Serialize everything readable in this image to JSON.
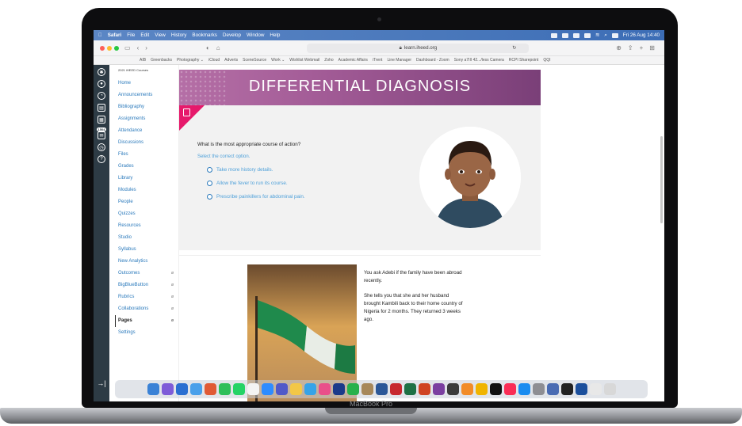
{
  "menubar": {
    "app": "Safari",
    "items": [
      "File",
      "Edit",
      "View",
      "History",
      "Bookmarks",
      "Develop",
      "Window",
      "Help"
    ],
    "clock": "Fri 26 Aug  14:40"
  },
  "toolbar": {
    "url": "learn.iheed.org",
    "favorites": [
      "AIB",
      "Greenbacks",
      "Photography ⌄",
      "iCloud",
      "Adverts",
      "SceneSource",
      "Work ⌄",
      "Wishlist Webmail",
      "Zoho",
      "Academic Affairs",
      "iTrent",
      "Line Manager",
      "Dashboard - Zoom",
      "Sony a7III 42.../less Camera",
      "RCPI Sharepoint",
      "QQI"
    ]
  },
  "global_nav": {
    "badge": "1504"
  },
  "course_nav": {
    "crumb": "2021 iHEED Courses",
    "items": [
      {
        "label": "Home",
        "eye": ""
      },
      {
        "label": "Announcements",
        "eye": ""
      },
      {
        "label": "Bibliography",
        "eye": ""
      },
      {
        "label": "Assignments",
        "eye": ""
      },
      {
        "label": "Attendance",
        "eye": ""
      },
      {
        "label": "Discussions",
        "eye": ""
      },
      {
        "label": "Files",
        "eye": ""
      },
      {
        "label": "Grades",
        "eye": ""
      },
      {
        "label": "Library",
        "eye": ""
      },
      {
        "label": "Modules",
        "eye": ""
      },
      {
        "label": "People",
        "eye": ""
      },
      {
        "label": "Quizzes",
        "eye": ""
      },
      {
        "label": "Resources",
        "eye": ""
      },
      {
        "label": "Studio",
        "eye": ""
      },
      {
        "label": "Syllabus",
        "eye": ""
      },
      {
        "label": "New Analytics",
        "eye": ""
      },
      {
        "label": "Outcomes",
        "eye": "ø"
      },
      {
        "label": "BigBlueButton",
        "eye": "ø"
      },
      {
        "label": "Rubrics",
        "eye": "ø"
      },
      {
        "label": "Collaborations",
        "eye": "ø"
      },
      {
        "label": "Pages",
        "eye": "ø"
      },
      {
        "label": "Settings",
        "eye": ""
      }
    ]
  },
  "page": {
    "banner_title": "DIFFERENTIAL DIAGNOSIS",
    "question": "What is the most appropriate course of action?",
    "hint": "Select the correct option.",
    "options": [
      "Take more history details.",
      "Allow the fever to run its course.",
      "Prescribe painkillers for abdominal pain."
    ],
    "story": [
      "You ask Adebi if the family have been abroad recently.",
      "She tells you that she and her husband brought Kambili back to their home country of Nigeria for 2 months. They returned 3 weeks ago."
    ]
  },
  "device": {
    "label": "MacBook Pro"
  },
  "colors": {
    "accent": "#e6196b",
    "link": "#4ea0d9",
    "banner": "#a25b96",
    "nav_dark": "#2d3b45"
  }
}
